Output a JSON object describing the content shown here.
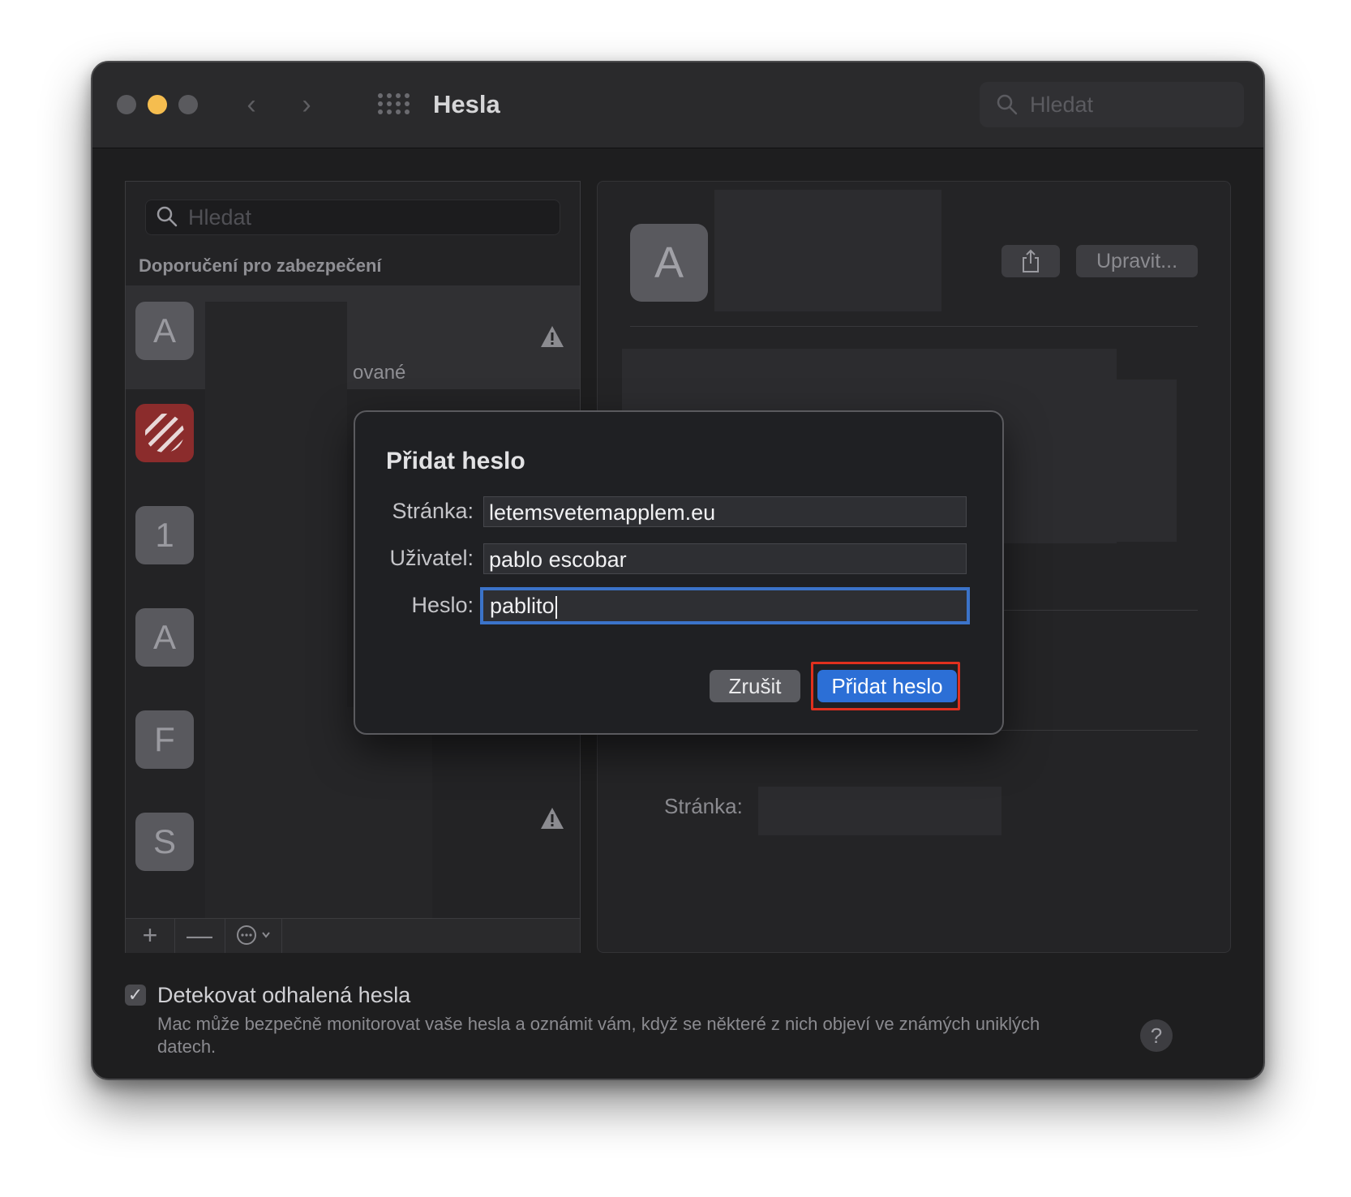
{
  "window": {
    "title": "Hesla",
    "search_placeholder": "Hledat"
  },
  "sidebar": {
    "search_placeholder": "Hledat",
    "section_heading": "Doporučení pro zabezpečení",
    "partial_text": "ované",
    "items": [
      {
        "avatar": "A",
        "warning": true
      },
      {
        "avatar": "",
        "icon": "striped-app-icon",
        "warning": false
      },
      {
        "avatar": "1",
        "warning": false
      },
      {
        "avatar": "A",
        "warning": false
      },
      {
        "avatar": "F",
        "warning": true
      },
      {
        "avatar": "S",
        "warning": true
      }
    ],
    "bottom": {
      "add": "+",
      "remove": "—",
      "more": "⋯"
    }
  },
  "detail": {
    "avatar": "A",
    "edit_label": "Upravit...",
    "site_label": "Stránka:"
  },
  "footer": {
    "checkbox_label": "Detekovat odhalená hesla",
    "checked": true,
    "description": "Mac může bezpečně monitorovat vaše hesla a oznámit vám, když se některé z nich objeví ve známých uniklých datech.",
    "help": "?"
  },
  "dialog": {
    "title": "Přidat heslo",
    "fields": {
      "site_label": "Stránka:",
      "site_value": "letemsvetemapplem.eu",
      "user_label": "Uživatel:",
      "user_value": "pablo escobar",
      "password_label": "Heslo:",
      "password_value": "pablito"
    },
    "cancel_label": "Zrušit",
    "submit_label": "Přidat heslo"
  },
  "colors": {
    "accent": "#2c6fd6",
    "highlight": "#e0301e",
    "traffic_close": "#5a5a5e",
    "traffic_minimize": "#f5bd4f",
    "traffic_zoom": "#5a5a5e"
  }
}
